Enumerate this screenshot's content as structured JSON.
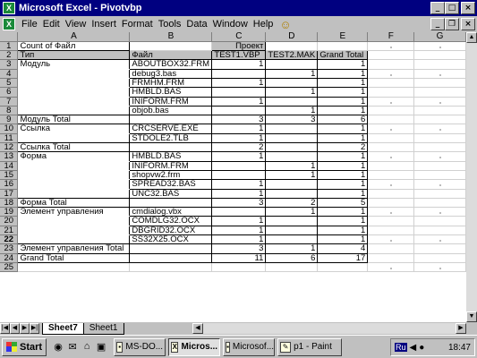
{
  "window": {
    "title": "Microsoft Excel - Pivotvbp",
    "app_icon": "X"
  },
  "title_buttons": {
    "minimize": "_",
    "maximize": "□",
    "close": "×"
  },
  "menu": {
    "items": [
      "File",
      "Edit",
      "View",
      "Insert",
      "Format",
      "Tools",
      "Data",
      "Window",
      "Help"
    ],
    "smiley": "☺"
  },
  "doc_buttons": {
    "minimize": "_",
    "restore": "❐",
    "close": "×"
  },
  "columns": [
    "A",
    "B",
    "C",
    "D",
    "E",
    "F",
    "G"
  ],
  "rows": [
    {
      "n": "1",
      "a": "Count of Файл",
      "b": "",
      "c": "Проект",
      "d": "",
      "e": ""
    },
    {
      "n": "2",
      "a": "Тип",
      "b": "Файл",
      "c": "TEST1.VBP",
      "d": "TEST2.MAK",
      "e": "Grand Total"
    },
    {
      "n": "3",
      "a": "Модуль",
      "b": "ABOUTBOX32.FRM",
      "c": "1",
      "d": "",
      "e": "1"
    },
    {
      "n": "4",
      "a": "",
      "b": "debug3.bas",
      "c": "",
      "d": "1",
      "e": "1"
    },
    {
      "n": "5",
      "a": "",
      "b": "FRMHM.FRM",
      "c": "1",
      "d": "",
      "e": "1"
    },
    {
      "n": "6",
      "a": "",
      "b": "HMBLD.BAS",
      "c": "",
      "d": "1",
      "e": "1"
    },
    {
      "n": "7",
      "a": "",
      "b": "INIFORM.FRM",
      "c": "1",
      "d": "",
      "e": "1"
    },
    {
      "n": "8",
      "a": "",
      "b": "objob.bas",
      "c": "",
      "d": "1",
      "e": "1"
    },
    {
      "n": "9",
      "a": "Модуль Total",
      "b": "",
      "c": "3",
      "d": "3",
      "e": "6"
    },
    {
      "n": "10",
      "a": "Ссылка",
      "b": "CRCSERVE.EXE",
      "c": "1",
      "d": "",
      "e": "1"
    },
    {
      "n": "11",
      "a": "",
      "b": "STDOLE2.TLB",
      "c": "1",
      "d": "",
      "e": "1"
    },
    {
      "n": "12",
      "a": "Ссылка Total",
      "b": "",
      "c": "2",
      "d": "",
      "e": "2"
    },
    {
      "n": "13",
      "a": "Форма",
      "b": "HMBLD.BAS",
      "c": "1",
      "d": "",
      "e": "1"
    },
    {
      "n": "14",
      "a": "",
      "b": "INIFORM.FRM",
      "c": "",
      "d": "1",
      "e": "1"
    },
    {
      "n": "15",
      "a": "",
      "b": "shopvw2.frm",
      "c": "",
      "d": "1",
      "e": "1"
    },
    {
      "n": "16",
      "a": "",
      "b": "SPREAD32.BAS",
      "c": "1",
      "d": "",
      "e": "1"
    },
    {
      "n": "17",
      "a": "",
      "b": "UNC32.BAS",
      "c": "1",
      "d": "",
      "e": "1"
    },
    {
      "n": "18",
      "a": "Форма Total",
      "b": "",
      "c": "3",
      "d": "2",
      "e": "5"
    },
    {
      "n": "19",
      "a": "Элемент управления",
      "b": "cmdialog.vbx",
      "c": "",
      "d": "1",
      "e": "1"
    },
    {
      "n": "20",
      "a": "",
      "b": "COMDLG32.OCX",
      "c": "1",
      "d": "",
      "e": "1"
    },
    {
      "n": "21",
      "a": "",
      "b": "DBGRID32.OCX",
      "c": "1",
      "d": "",
      "e": "1"
    },
    {
      "n": "22",
      "a": "",
      "b": "SS32X25.OCX",
      "c": "1",
      "d": "",
      "e": "1"
    },
    {
      "n": "23",
      "a": "Элемент управления Total",
      "b": "",
      "c": "3",
      "d": "1",
      "e": "4"
    },
    {
      "n": "24",
      "a": "Grand Total",
      "b": "",
      "c": "11",
      "d": "6",
      "e": "17"
    },
    {
      "n": "25",
      "a": "",
      "b": "",
      "c": "",
      "d": "",
      "e": ""
    }
  ],
  "tabs": [
    "Sheet7",
    "Sheet1"
  ],
  "tab_nav": [
    "|◀",
    "◀",
    "▶",
    "▶|"
  ],
  "taskbar": {
    "start": "Start",
    "quicklaunch": [
      "◉",
      "✉",
      "⌂",
      "▣"
    ],
    "buttons": [
      "MS-DO...",
      "Micros...",
      "Microsof...",
      "p1 - Paint"
    ],
    "lang": "Ru",
    "clock": "18:47"
  }
}
